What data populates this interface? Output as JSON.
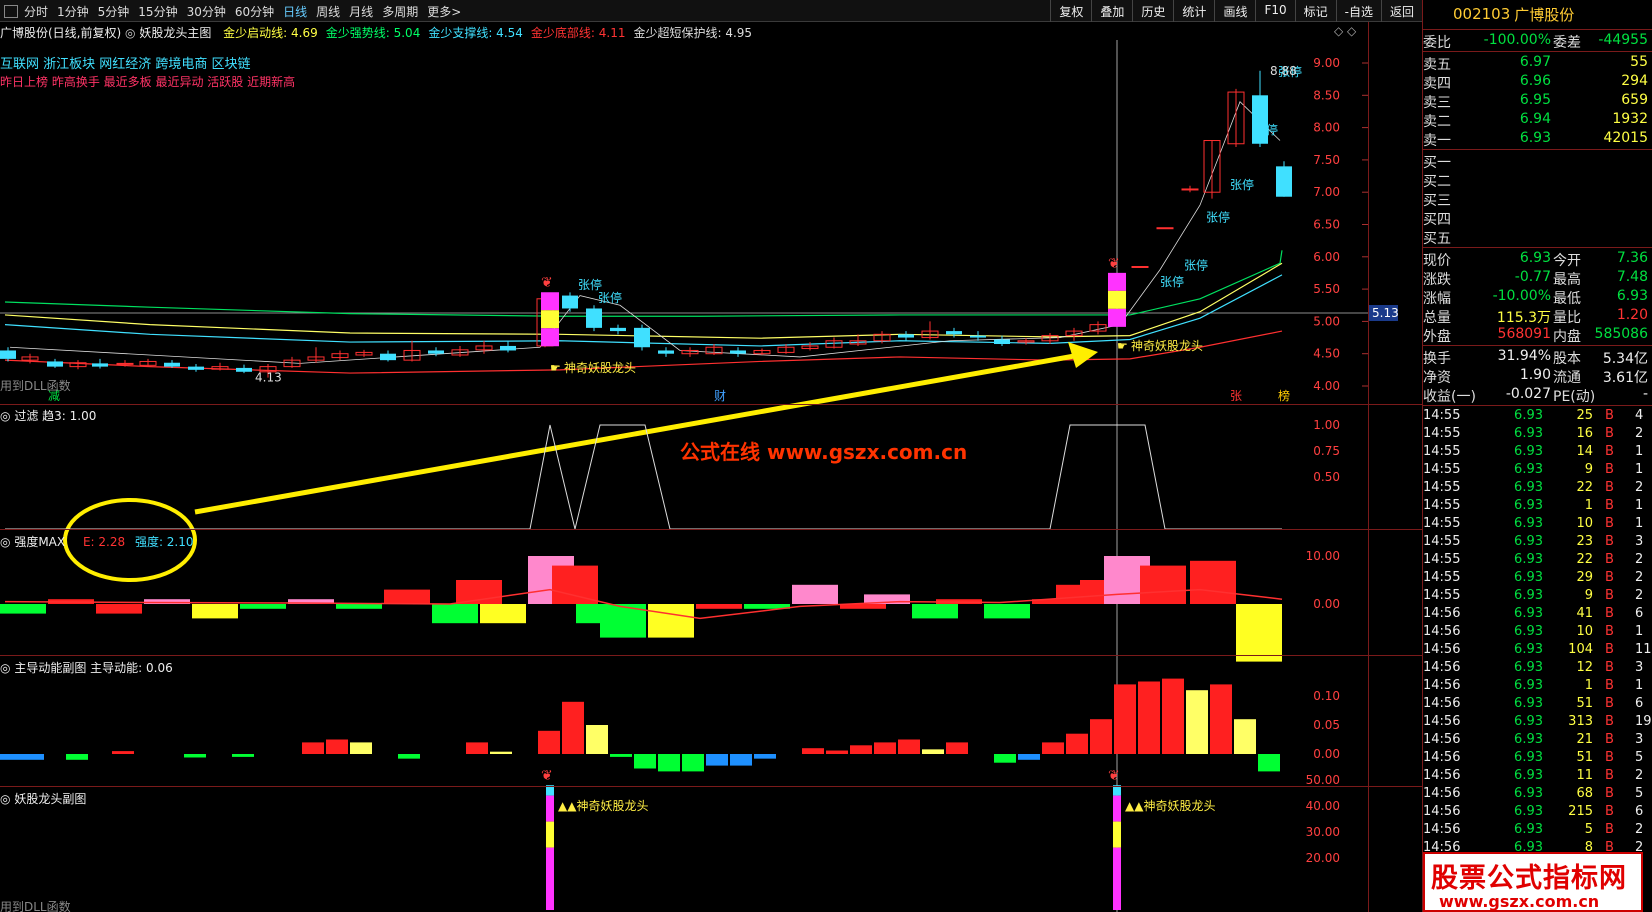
{
  "toolbar": {
    "periods": [
      "分时",
      "1分钟",
      "5分钟",
      "15分钟",
      "30分钟",
      "60分钟",
      "日线",
      "周线",
      "月线",
      "多周期",
      "更多>"
    ],
    "active_period": "日线",
    "tools": [
      "复权",
      "叠加",
      "历史",
      "统计",
      "画线",
      "F10",
      "标记",
      "-自选",
      "返回"
    ]
  },
  "main_panel": {
    "stock_label": "广博股份(日线,前复权)",
    "indicator_name": "妖股龙头主图",
    "lines": [
      {
        "name": "金少启动线: 4.69",
        "color": "#ffff44"
      },
      {
        "name": "金少强势线: 5.04",
        "color": "#00ff66"
      },
      {
        "name": "金少支撑线: 4.54",
        "color": "#40e0ff"
      },
      {
        "name": "金少底部线: 4.11",
        "color": "#ff3333"
      },
      {
        "name": "金少超短保护线: 4.95",
        "color": "#dddddd"
      }
    ],
    "concepts": "互联网 浙江板块 网红经济 跨境电商 区块链",
    "tags": "昨日上榜 昨高换手 最近多板 最近异动 活跃股 近期新高",
    "y_ticks": [
      "9.00",
      "8.50",
      "8.00",
      "7.50",
      "7.00",
      "6.50",
      "6.00",
      "5.50",
      "5.00",
      "4.50",
      "4.00"
    ],
    "high_label": "8.88",
    "low_label": "4.13",
    "current_price_tag": "5.13",
    "limit_up_label": "张停",
    "signal_label": "神奇妖股龙头",
    "dll_note": "用到DLL函数",
    "event_markers": [
      {
        "text": "减",
        "color": "#00e040"
      },
      {
        "text": "财",
        "color": "#40a0ff"
      },
      {
        "text": "张",
        "color": "#ff3333"
      },
      {
        "text": "榜",
        "color": "#ffcc00"
      }
    ]
  },
  "filter_panel": {
    "title": "过滤",
    "value_label": "趋3: 1.00",
    "y_ticks": [
      "1.00",
      "0.75",
      "0.50"
    ],
    "watermark": "公式在线  www.gszx.com.cn"
  },
  "strength_panel": {
    "title": "强度MAX",
    "e_label": "E: 2.28",
    "strength_label": "强度: 2.10",
    "y_ticks": [
      "10.00",
      "0.00"
    ]
  },
  "momentum_panel": {
    "title": "主导动能副图",
    "value_label": "主导动能: 0.06",
    "y_ticks": [
      "0.10",
      "0.05",
      "0.00"
    ]
  },
  "sub_panel": {
    "title": "妖股龙头副图",
    "signal_label": "▲▲神奇妖股龙头",
    "dll_note": "用到DLL函数",
    "y_ticks": [
      "50.00",
      "40.00",
      "30.00",
      "20.00"
    ]
  },
  "quote": {
    "code": "002103",
    "name": "广博股份",
    "webi": {
      "l1": "委比",
      "v1": "-100.00%",
      "l2": "委差",
      "v2": "-44955"
    },
    "asks": [
      {
        "label": "卖五",
        "price": "6.97",
        "vol": "55"
      },
      {
        "label": "卖四",
        "price": "6.96",
        "vol": "294"
      },
      {
        "label": "卖三",
        "price": "6.95",
        "vol": "659"
      },
      {
        "label": "卖二",
        "price": "6.94",
        "vol": "1932"
      },
      {
        "label": "卖一",
        "price": "6.93",
        "vol": "42015"
      }
    ],
    "bids": [
      "买一",
      "买二",
      "买三",
      "买四",
      "买五"
    ],
    "stats": [
      {
        "l1": "现价",
        "v1": "6.93",
        "c1": "green",
        "l2": "今开",
        "v2": "7.36",
        "c2": "green"
      },
      {
        "l1": "涨跌",
        "v1": "-0.77",
        "c1": "green",
        "l2": "最高",
        "v2": "7.48",
        "c2": "green"
      },
      {
        "l1": "涨幅",
        "v1": "-10.00%",
        "c1": "green",
        "l2": "最低",
        "v2": "6.93",
        "c2": "green"
      },
      {
        "l1": "总量",
        "v1": "115.3万",
        "c1": "yellow",
        "l2": "量比",
        "v2": "1.20",
        "c2": "red"
      },
      {
        "l1": "外盘",
        "v1": "568091",
        "c1": "red",
        "l2": "内盘",
        "v2": "585086",
        "c2": "green"
      }
    ],
    "fin": [
      {
        "l1": "换手",
        "v1": "31.94%",
        "l2": "股本",
        "v2": "5.34亿"
      },
      {
        "l1": "净资",
        "v1": "1.90",
        "l2": "流通",
        "v2": "3.61亿"
      },
      {
        "l1": "收益(一)",
        "v1": "-0.027",
        "l2": "PE(动)",
        "v2": "-"
      }
    ],
    "ticks": [
      {
        "time": "14:55",
        "price": "6.93",
        "vol": "25",
        "bs": "B",
        "n": "4"
      },
      {
        "time": "14:55",
        "price": "6.93",
        "vol": "16",
        "bs": "B",
        "n": "2"
      },
      {
        "time": "14:55",
        "price": "6.93",
        "vol": "14",
        "bs": "B",
        "n": "1"
      },
      {
        "time": "14:55",
        "price": "6.93",
        "vol": "9",
        "bs": "B",
        "n": "1"
      },
      {
        "time": "14:55",
        "price": "6.93",
        "vol": "22",
        "bs": "B",
        "n": "2"
      },
      {
        "time": "14:55",
        "price": "6.93",
        "vol": "1",
        "bs": "B",
        "n": "1"
      },
      {
        "time": "14:55",
        "price": "6.93",
        "vol": "10",
        "bs": "B",
        "n": "1"
      },
      {
        "time": "14:55",
        "price": "6.93",
        "vol": "23",
        "bs": "B",
        "n": "3"
      },
      {
        "time": "14:55",
        "price": "6.93",
        "vol": "22",
        "bs": "B",
        "n": "2"
      },
      {
        "time": "14:55",
        "price": "6.93",
        "vol": "29",
        "bs": "B",
        "n": "2"
      },
      {
        "time": "14:55",
        "price": "6.93",
        "vol": "9",
        "bs": "B",
        "n": "2"
      },
      {
        "time": "14:56",
        "price": "6.93",
        "vol": "41",
        "bs": "B",
        "n": "6"
      },
      {
        "time": "14:56",
        "price": "6.93",
        "vol": "10",
        "bs": "B",
        "n": "1"
      },
      {
        "time": "14:56",
        "price": "6.93",
        "vol": "104",
        "bs": "B",
        "n": "11"
      },
      {
        "time": "14:56",
        "price": "6.93",
        "vol": "12",
        "bs": "B",
        "n": "3"
      },
      {
        "time": "14:56",
        "price": "6.93",
        "vol": "1",
        "bs": "B",
        "n": "1"
      },
      {
        "time": "14:56",
        "price": "6.93",
        "vol": "51",
        "bs": "B",
        "n": "6"
      },
      {
        "time": "14:56",
        "price": "6.93",
        "vol": "313",
        "bs": "B",
        "n": "19"
      },
      {
        "time": "14:56",
        "price": "6.93",
        "vol": "21",
        "bs": "B",
        "n": "3"
      },
      {
        "time": "14:56",
        "price": "6.93",
        "vol": "51",
        "bs": "B",
        "n": "5"
      },
      {
        "time": "14:56",
        "price": "6.93",
        "vol": "11",
        "bs": "B",
        "n": "2"
      },
      {
        "time": "14:56",
        "price": "6.93",
        "vol": "68",
        "bs": "B",
        "n": "5"
      },
      {
        "time": "14:56",
        "price": "6.93",
        "vol": "215",
        "bs": "B",
        "n": "6"
      },
      {
        "time": "14:56",
        "price": "6.93",
        "vol": "5",
        "bs": "B",
        "n": "2"
      },
      {
        "time": "14:56",
        "price": "6.93",
        "vol": "8",
        "bs": "B",
        "n": "2"
      }
    ]
  },
  "watermark": {
    "title": "股票公式指标网",
    "url": "www.gszx.com.cn"
  }
}
